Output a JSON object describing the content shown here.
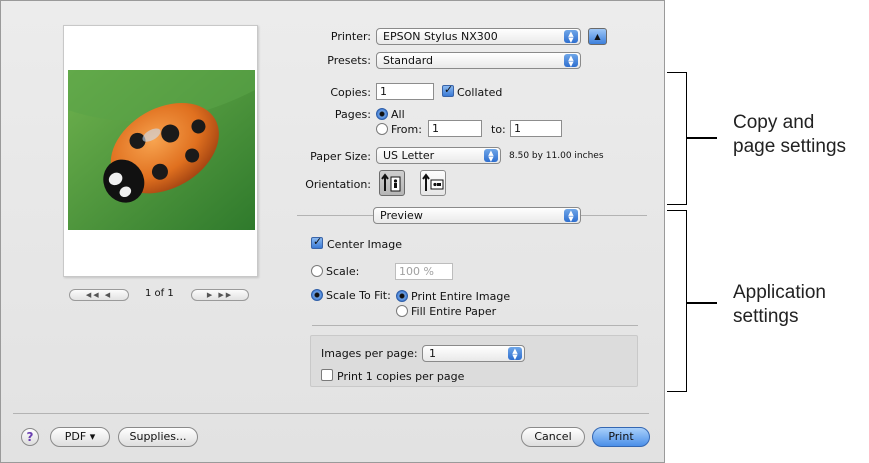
{
  "printer": {
    "label": "Printer:",
    "value": "EPSON Stylus NX300"
  },
  "presets": {
    "label": "Presets:",
    "value": "Standard"
  },
  "copies": {
    "label": "Copies:",
    "value": "1",
    "collated_label": "Collated",
    "collated": true
  },
  "pages": {
    "label": "Pages:",
    "all_label": "All",
    "from_label": "From:",
    "from_value": "1",
    "to_label": "to:",
    "to_value": "1",
    "selected": "All"
  },
  "paper_size": {
    "label": "Paper Size:",
    "value": "US Letter",
    "dimensions": "8.50 by 11.00 inches"
  },
  "orientation": {
    "label": "Orientation:",
    "selected": "portrait"
  },
  "section_popup": {
    "value": "Preview"
  },
  "center_image": {
    "label": "Center Image",
    "checked": true
  },
  "scale": {
    "label": "Scale:",
    "value": "100 %"
  },
  "scale_to_fit": {
    "label": "Scale To Fit:",
    "print_entire_label": "Print Entire Image",
    "fill_entire_label": "Fill Entire Paper",
    "selected": "Print Entire Image"
  },
  "images_per_page": {
    "label": "Images per page:",
    "value": "1"
  },
  "print_copies": {
    "label": "Print 1 copies per page",
    "checked": false
  },
  "preview_nav": {
    "page_text": "1 of 1"
  },
  "footer": {
    "help": "?",
    "pdf_label": "PDF ▾",
    "supplies_label": "Supplies...",
    "cancel_label": "Cancel",
    "print_label": "Print"
  },
  "annotations": {
    "copy_page_line1": "Copy and",
    "copy_page_line2": "page settings",
    "app_line1": "Application",
    "app_line2": "settings"
  },
  "colors": {
    "accent": "#3b7ad5",
    "dialog_bg": "#e6e6e6",
    "photo_bg": "#4a9a3c",
    "ladybug": "#e0701f"
  }
}
